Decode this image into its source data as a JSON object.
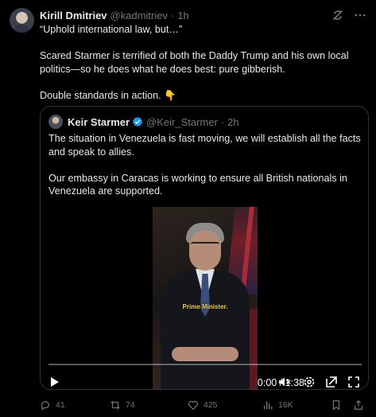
{
  "post": {
    "author_name": "Kirill Dmitriev",
    "author_handle": "@kadmitriev",
    "separator": "·",
    "time": "1h",
    "text": "“Uphold international law, but…”\n\nScared Starmer is terrified of both the Daddy Trump and his own local politics—so he does what he does best: pure gibberish.\n\nDouble standards in action. 👇"
  },
  "quote": {
    "author_name": "Keir Starmer",
    "author_handle": "@Keir_Starmer",
    "separator": "·",
    "time": "2h",
    "text": "The situation in Venezuela is fast moving, we will establish all the facts and speak to allies.\n\nOur embassy in Caracas is working to ensure all British nationals in Venezuela are supported."
  },
  "video": {
    "caption": "Prime Minister.",
    "time_display": "0:00 / 1:38",
    "progress": 0
  },
  "actions": {
    "replies": "41",
    "reposts": "74",
    "likes": "425",
    "views": "16K"
  },
  "icons": {
    "header": [
      "grok-icon",
      "more-icon"
    ],
    "video_controls": [
      "play-icon",
      "mute-icon",
      "settings-icon",
      "popout-icon",
      "fullscreen-icon"
    ],
    "actions": [
      "reply-icon",
      "repost-icon",
      "like-icon",
      "views-icon",
      "bookmark-icon",
      "share-icon"
    ]
  },
  "colors": {
    "background": "#000000",
    "text": "#e7e9ea",
    "muted": "#71767b",
    "border": "#2f3336",
    "verified": "#1d9bf0",
    "caption": "#f5d33a"
  }
}
